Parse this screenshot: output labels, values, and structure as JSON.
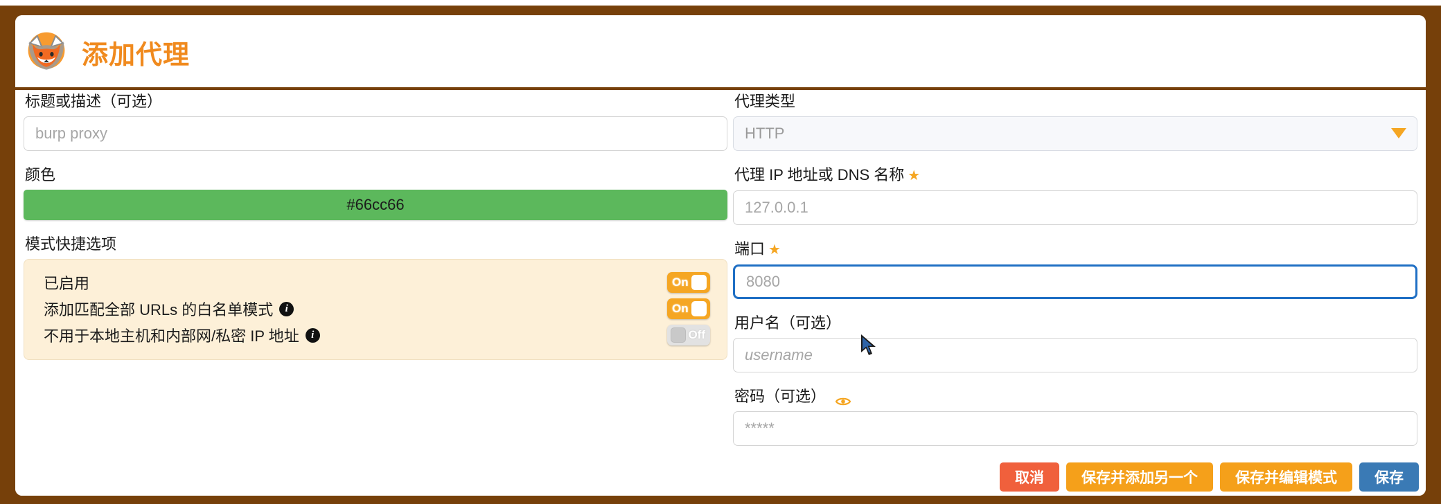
{
  "window": {
    "title": "添加代理",
    "logo_icon": "foxyproxy-fox-icon",
    "frame_color": "#76400a",
    "title_color": "#f08a1e"
  },
  "left": {
    "title_field": {
      "label": "标题或描述（可选）",
      "value": "",
      "placeholder": "burp proxy"
    },
    "color_field": {
      "label": "颜色",
      "value": "#66cc66",
      "swatch_color": "#5cb85c"
    },
    "pattern_shortcuts": {
      "label": "模式快捷选项",
      "rows": [
        {
          "label": "已启用",
          "has_info": false,
          "state": "On"
        },
        {
          "label": "添加匹配全部 URLs 的白名单模式",
          "has_info": true,
          "info_icon": "info-icon",
          "state": "On"
        },
        {
          "label": "不用于本地主机和内部网/私密 IP 地址",
          "has_info": true,
          "info_icon": "info-icon",
          "state": "Off"
        }
      ]
    }
  },
  "right": {
    "proxy_type": {
      "label": "代理类型",
      "selected": "HTTP",
      "caret_icon": "chevron-down-icon"
    },
    "host_field": {
      "label": "代理 IP 地址或 DNS 名称",
      "required_icon": "star-icon",
      "value": "",
      "placeholder": "127.0.0.1"
    },
    "port_field": {
      "label": "端口",
      "required_icon": "star-icon",
      "value": "",
      "placeholder": "8080",
      "focused": true
    },
    "username_field": {
      "label": "用户名（可选）",
      "value": "",
      "placeholder": "username"
    },
    "password_field": {
      "label": "密码（可选）",
      "reveal_icon": "eye-icon",
      "value": "",
      "placeholder": "*****"
    }
  },
  "buttons": {
    "cancel": "取消",
    "save_add_another": "保存并添加另一个",
    "save_edit_patterns": "保存并编辑模式",
    "save": "保存"
  },
  "cursor": {
    "icon": "mouse-pointer-icon"
  }
}
